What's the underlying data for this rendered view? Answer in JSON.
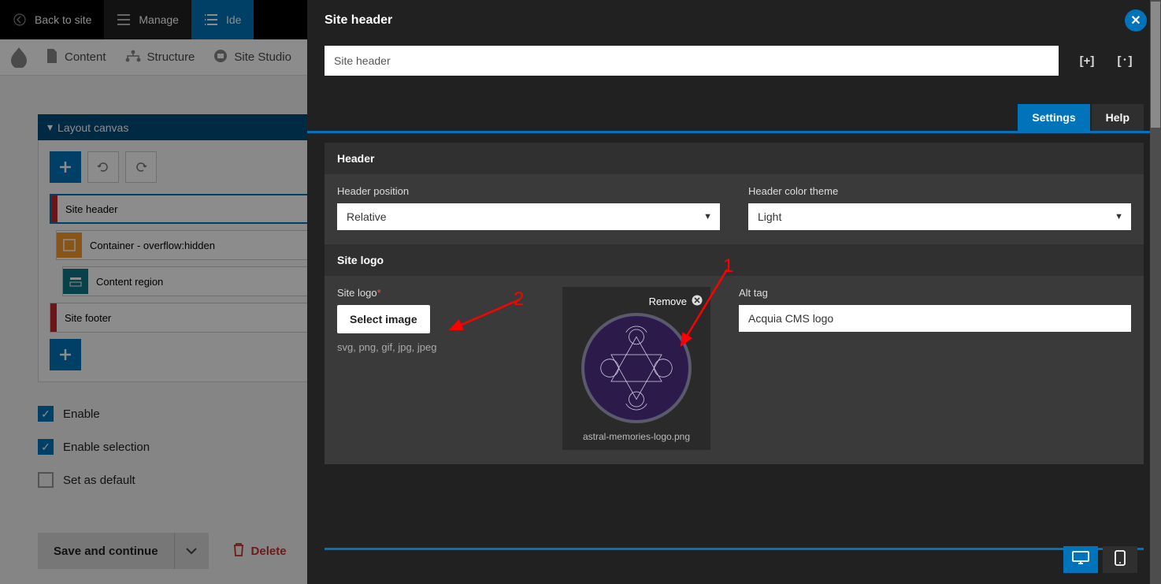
{
  "topbar": {
    "back": "Back to site",
    "manage": "Manage",
    "ide": "Ide"
  },
  "adminmenu": {
    "content": "Content",
    "structure": "Structure",
    "sitestudio": "Site Studio"
  },
  "layout_canvas": {
    "title": "Layout canvas",
    "items": [
      {
        "label": "Site header"
      },
      {
        "label": "Container - overflow:hidden"
      },
      {
        "label": "Content region"
      },
      {
        "label": "Site footer"
      }
    ]
  },
  "options": {
    "enable": "Enable",
    "enable_selection": "Enable selection",
    "set_default": "Set as default"
  },
  "save_row": {
    "save": "Save and continue",
    "delete": "Delete"
  },
  "modal": {
    "title": "Site header",
    "name_value": "Site header",
    "tabs": {
      "settings": "Settings",
      "help": "Help"
    },
    "section_header": "Header",
    "header_position_label": "Header position",
    "header_position_value": "Relative",
    "header_theme_label": "Header color theme",
    "header_theme_value": "Light",
    "section_logo": "Site logo",
    "site_logo_label": "Site logo",
    "select_image": "Select image",
    "file_hint": "svg, png, gif, jpg, jpeg",
    "remove": "Remove",
    "img_filename": "astral-memories-logo.png",
    "alt_label": "Alt tag",
    "alt_value": "Acquia CMS logo"
  },
  "annotations": {
    "one": "1",
    "two": "2"
  }
}
